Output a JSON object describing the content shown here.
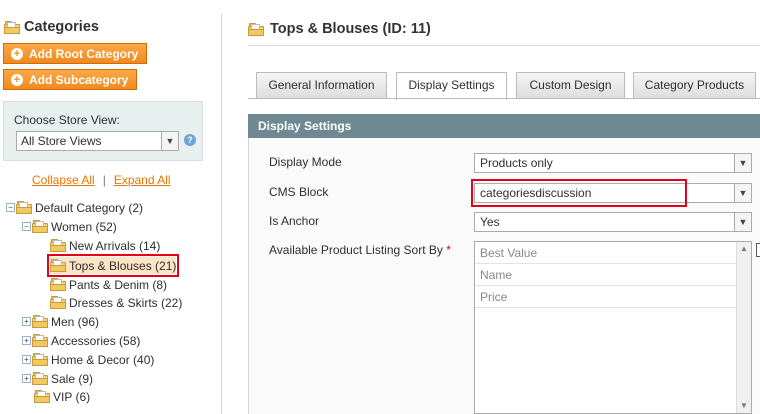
{
  "sidebar": {
    "title": "Categories",
    "add_root": "Add Root Category",
    "add_sub": "Add Subcategory",
    "store_view_label": "Choose Store View:",
    "store_view_value": "All Store Views",
    "collapse_all": "Collapse All",
    "expand_all": "Expand All",
    "separator": "|",
    "tree": [
      {
        "label": "Default Category (2)",
        "expander": "−"
      },
      {
        "label": "Women (52)",
        "expander": "−"
      },
      {
        "label": "New Arrivals (14)"
      },
      {
        "label": "Tops & Blouses (21)",
        "selected": true
      },
      {
        "label": "Pants & Denim (8)"
      },
      {
        "label": "Dresses & Skirts (22)"
      },
      {
        "label": "Men (96)",
        "expander": "+"
      },
      {
        "label": "Accessories (58)",
        "expander": "+"
      },
      {
        "label": "Home & Decor (40)",
        "expander": "+"
      },
      {
        "label": "Sale (9)",
        "expander": "+"
      },
      {
        "label": "VIP (6)"
      }
    ]
  },
  "main": {
    "title": "Tops & Blouses (ID: 11)",
    "tabs": [
      {
        "label": "General Information"
      },
      {
        "label": "Display Settings",
        "active": true
      },
      {
        "label": "Custom Design"
      },
      {
        "label": "Category Products"
      }
    ],
    "panel_title": "Display Settings",
    "fields": {
      "display_mode": {
        "label": "Display Mode",
        "value": "Products only"
      },
      "cms_block": {
        "label": "CMS Block",
        "value": "categoriesdiscussion"
      },
      "is_anchor": {
        "label": "Is Anchor",
        "value": "Yes"
      },
      "sort_by": {
        "label": "Available Product Listing Sort By",
        "required_mark": "*",
        "options": [
          "Best Value",
          "Name",
          "Price"
        ]
      }
    }
  },
  "colors": {
    "accent_orange": "#f18a1d",
    "panel_header": "#6f8992",
    "highlight_red": "#e3001b",
    "link_orange": "#ea7601"
  }
}
